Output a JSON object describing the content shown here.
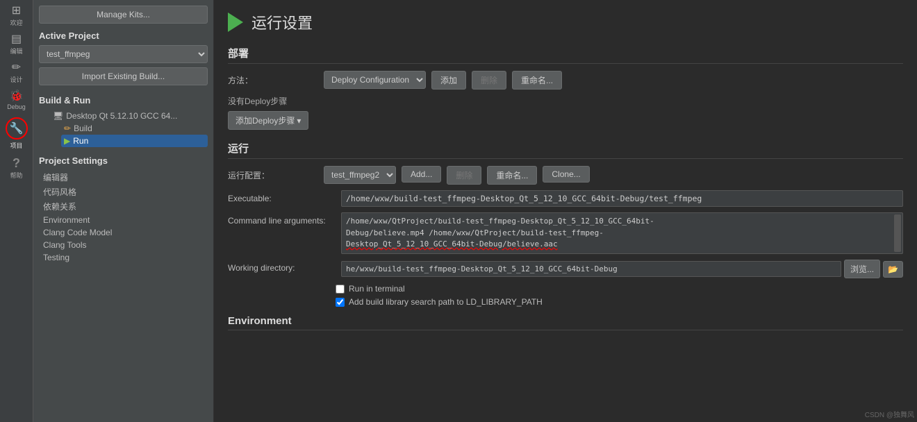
{
  "iconBar": {
    "items": [
      {
        "id": "grid",
        "symbol": "⊞",
        "label": "欢迎"
      },
      {
        "id": "edit",
        "symbol": "▤",
        "label": "编辑"
      },
      {
        "id": "design",
        "symbol": "✏",
        "label": "设计"
      },
      {
        "id": "debug",
        "symbol": "🐞",
        "label": "Debug"
      },
      {
        "id": "project",
        "symbol": "🔧",
        "label": "项目",
        "active": true,
        "circled": true
      },
      {
        "id": "help",
        "symbol": "?",
        "label": "帮助"
      }
    ]
  },
  "sidebar": {
    "manageKits": "Manage Kits...",
    "activeProject": {
      "title": "Active Project",
      "selected": "test_ffmpeg"
    },
    "importBtn": "Import Existing Build...",
    "buildRun": {
      "title": "Build & Run",
      "items": [
        {
          "id": "desktop",
          "label": "Desktop Qt 5.12.10 GCC 64...",
          "icon": "🖥",
          "level": 1
        },
        {
          "id": "build",
          "label": "Build",
          "icon": "✏",
          "level": 2
        },
        {
          "id": "run",
          "label": "Run",
          "icon": "▶",
          "level": 2,
          "active": true
        }
      ]
    },
    "projectSettings": {
      "title": "Project Settings",
      "links": [
        "编辑器",
        "代码风格",
        "依赖关系",
        "Environment",
        "Clang Code Model",
        "Clang Tools",
        "Testing"
      ]
    }
  },
  "main": {
    "pageTitle": "运行设置",
    "deploy": {
      "sectionTitle": "部署",
      "methodLabel": "方法：",
      "selectedMethod": "Deploy Configuration",
      "addBtn": "添加",
      "deleteBtn": "删除",
      "renameBtn": "重命名...",
      "noDeployText": "没有Deploy步骤",
      "addDeployBtn": "添加Deploy步骤"
    },
    "run": {
      "sectionTitle": "运行",
      "configLabel": "运行配置：",
      "selectedConfig": "test_ffmpeg2",
      "addBtn": "Add...",
      "deleteBtn": "删除",
      "renameBtn": "重命名...",
      "cloneBtn": "Clone...",
      "fields": {
        "executable": {
          "label": "Executable:",
          "value": "/home/wxw/build-test_ffmpeg-Desktop_Qt_5_12_10_GCC_64bit-Debug/test_ffmpeg"
        },
        "commandLineArgs": {
          "label": "Command line arguments:",
          "line1": "/home/wxw/QtProject/build-test_ffmpeg-Desktop_Qt_5_12_10_GCC_64bit-",
          "line2": "Debug/believe.mp4 /home/wxw/QtProject/build-test_ffmpeg-",
          "line3": "Desktop_Qt_5_12_10_GCC_64bit-Debug/believe.aac"
        },
        "workingDirectory": {
          "label": "Working directory:",
          "value": "he/wxw/build-test_ffmpeg-Desktop_Qt_5_12_10_GCC_64bit-Debug"
        }
      },
      "runInTerminal": "Run in terminal",
      "addLibraryPath": "Add build library search path to LD_LIBRARY_PATH"
    },
    "environment": {
      "sectionTitle": "Environment"
    }
  },
  "watermark": "CSDN @独舞风"
}
